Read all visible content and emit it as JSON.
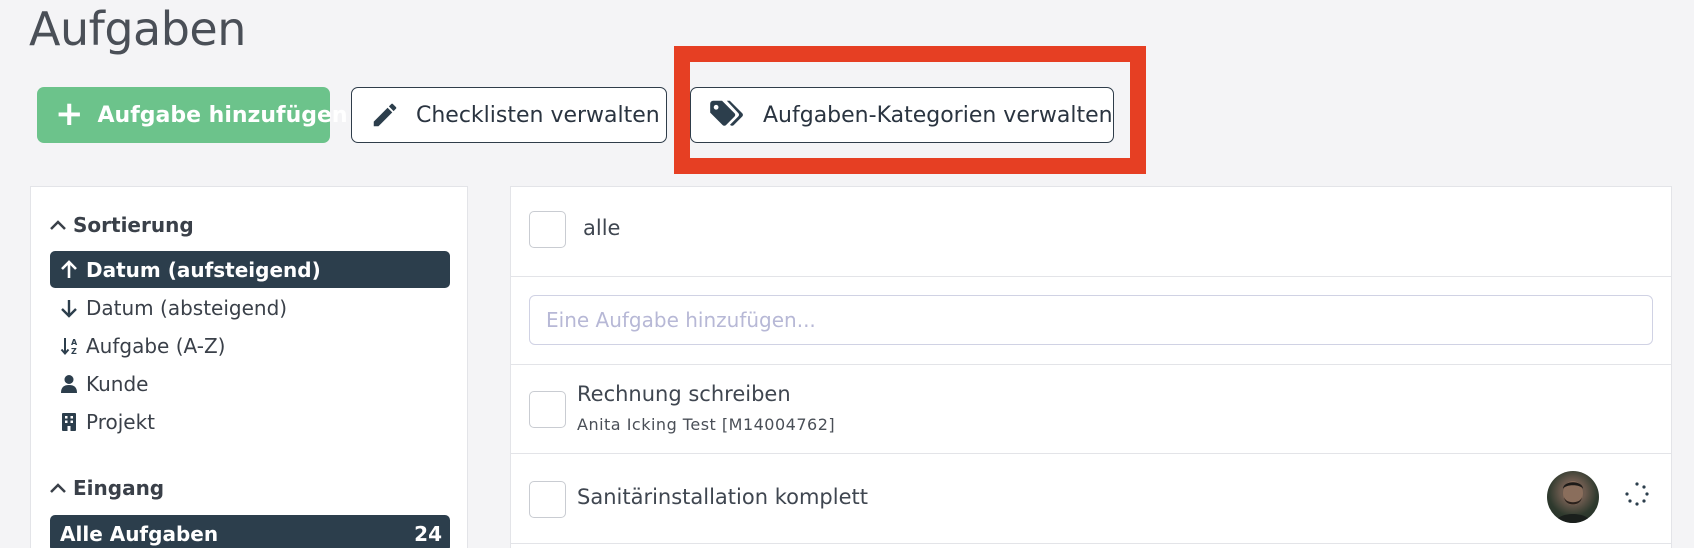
{
  "page": {
    "title": "Aufgaben"
  },
  "toolbar": {
    "add_label": "Aufgabe hinzufügen",
    "checklists_label": "Checklisten verwalten",
    "categories_label": "Aufgaben-Kategorien verwalten"
  },
  "sidebar": {
    "sort_heading": "Sortierung",
    "sort_items": [
      {
        "label": "Datum (aufsteigend)",
        "icon": "arrow-up-icon",
        "active": true
      },
      {
        "label": "Datum (absteigend)",
        "icon": "arrow-down-icon",
        "active": false
      },
      {
        "label": "Aufgabe (A-Z)",
        "icon": "sort-alpha-icon",
        "active": false
      },
      {
        "label": "Kunde",
        "icon": "user-icon",
        "active": false
      },
      {
        "label": "Projekt",
        "icon": "building-icon",
        "active": false
      }
    ],
    "inbox_heading": "Eingang",
    "inbox_items": [
      {
        "label": "Alle Aufgaben",
        "count": "24",
        "active": true
      }
    ]
  },
  "main": {
    "select_all_label": "alle",
    "new_task_placeholder": "Eine Aufgabe hinzufügen...",
    "tasks": [
      {
        "title": "Rechnung schreiben",
        "subtitle": "Anita Icking Test [M14004762]"
      },
      {
        "title": "Sanitärinstallation komplett"
      }
    ]
  },
  "colors": {
    "accent_green": "#6cc38b",
    "active_dark": "#2c3e4c",
    "highlight_red": "#e63f23"
  }
}
